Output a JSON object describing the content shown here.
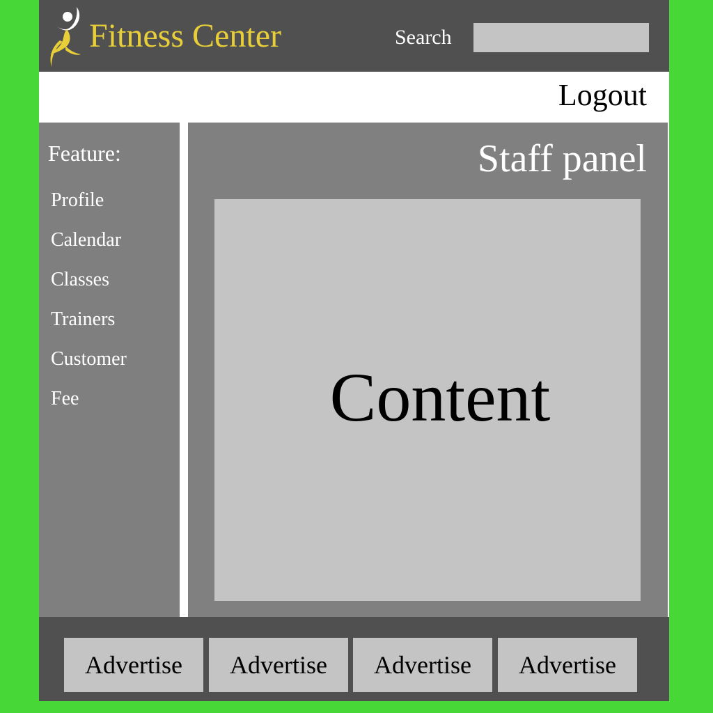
{
  "header": {
    "site_title": "Fitness Center",
    "search_label": "Search",
    "search_value": "",
    "logo_icon": "running-person-logo-icon"
  },
  "topbar": {
    "logout_label": "Logout"
  },
  "sidebar": {
    "heading": "Feature:",
    "items": [
      {
        "label": "Profile"
      },
      {
        "label": "Calendar"
      },
      {
        "label": "Classes"
      },
      {
        "label": "Trainers"
      },
      {
        "label": "Customer"
      },
      {
        "label": "Fee"
      }
    ]
  },
  "main": {
    "panel_title": "Staff panel",
    "content_label": "Content"
  },
  "footer": {
    "ads": [
      {
        "label": "Advertise"
      },
      {
        "label": "Advertise"
      },
      {
        "label": "Advertise"
      },
      {
        "label": "Advertise"
      }
    ]
  },
  "colors": {
    "background": "#47d837",
    "header_bg": "#505050",
    "title_yellow": "#e8cf3a",
    "sidebar_bg": "#7f7f7f",
    "panel_bg": "#808080",
    "box_gray": "#c4c4c4"
  }
}
